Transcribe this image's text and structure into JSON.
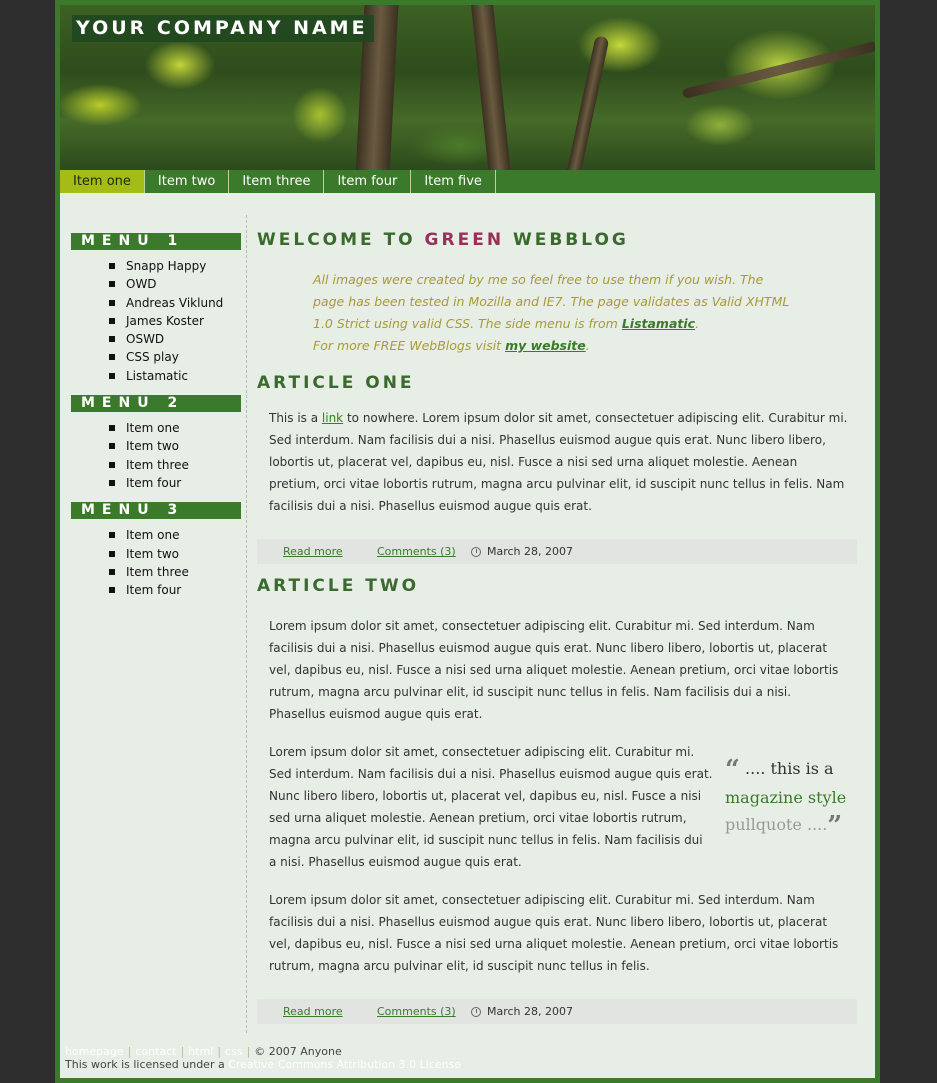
{
  "header": {
    "company": "YOUR COMPANY NAME"
  },
  "nav": {
    "items": [
      "Item one",
      "Item two",
      "Item three",
      "Item four",
      "Item five"
    ]
  },
  "sidebar": {
    "menus": [
      {
        "title": "MENU 1",
        "items": [
          "Snapp Happy",
          "OWD",
          "Andreas Viklund",
          "James Koster",
          "OSWD",
          "CSS play",
          "Listamatic"
        ]
      },
      {
        "title": "MENU 2",
        "items": [
          "Item one",
          "Item two",
          "Item three",
          "Item four"
        ]
      },
      {
        "title": "MENU 3",
        "items": [
          "Item one",
          "Item two",
          "Item three",
          "Item four"
        ]
      }
    ]
  },
  "main": {
    "title_pre": "WELCOME TO ",
    "title_green": "GREEN",
    "title_post": " WEBBLOG",
    "intro": {
      "t1": "All images were created by me so feel free to use them if you wish. The page has been tested in Mozilla and IE7. The page validates as Valid XHTML 1.0 Strict using valid CSS. The side menu is from ",
      "link1": "Listamatic",
      "t2": ".",
      "t3": "For more FREE WebBlogs visit ",
      "link2": "my website",
      "t4": "."
    },
    "article1": {
      "title": "ARTICLE ONE",
      "p_pre": "This is a ",
      "p_link": "link",
      "p_post": " to nowhere. Lorem ipsum dolor sit amet, consectetuer adipiscing elit. Curabitur mi. Sed interdum. Nam facilisis dui a nisi. Phasellus euismod augue quis erat. Nunc libero libero, lobortis ut, placerat vel, dapibus eu, nisl. Fusce a nisi sed urna aliquet molestie. Aenean pretium, orci vitae lobortis rutrum, magna arcu pulvinar elit, id suscipit nunc tellus in felis. Nam facilisis dui a nisi. Phasellus euismod augue quis erat.",
      "read_more": "Read more",
      "comments": "Comments (3)",
      "date": "March 28, 2007"
    },
    "article2": {
      "title": "ARTICLE TWO",
      "p1": "Lorem ipsum dolor sit amet, consectetuer adipiscing elit. Curabitur mi. Sed interdum. Nam facilisis dui a nisi. Phasellus euismod augue quis erat. Nunc libero libero, lobortis ut, placerat vel, dapibus eu, nisl. Fusce a nisi sed urna aliquet molestie. Aenean pretium, orci vitae lobortis rutrum, magna arcu pulvinar elit, id suscipit nunc tellus in felis. Nam facilisis dui a nisi. Phasellus euismod augue quis erat.",
      "p2": "Lorem ipsum dolor sit amet, consectetuer adipiscing elit. Curabitur mi. Sed interdum. Nam facilisis dui a nisi. Phasellus euismod augue quis erat. Nunc libero libero, lobortis ut, placerat vel, dapibus eu, nisl. Fusce a nisi sed urna aliquet molestie. Aenean pretium, orci vitae lobortis rutrum, magna arcu pulvinar elit, id suscipit nunc tellus in felis. Nam facilisis dui a nisi. Phasellus euismod augue quis erat.",
      "p3": "Lorem ipsum dolor sit amet, consectetuer adipiscing elit. Curabitur mi. Sed interdum. Nam facilisis dui a nisi. Phasellus euismod augue quis erat. Nunc libero libero, lobortis ut, placerat vel, dapibus eu, nisl. Fusce a nisi sed urna aliquet molestie. Aenean pretium, orci vitae lobortis rutrum, magna arcu pulvinar elit, id suscipit nunc tellus in felis.",
      "pullquote": {
        "open": "“",
        "a": " .... this is a ",
        "b": "magazine style",
        "c": "pullquote ....",
        "close": "”"
      },
      "read_more": "Read more",
      "comments": "Comments (3)",
      "date": "March 28, 2007"
    }
  },
  "footer": {
    "links": [
      "homepage",
      "contact",
      "html",
      "css"
    ],
    "sep": "|",
    "copyright": "© 2007 Anyone",
    "license_pre": "This work is licensed under a ",
    "license_link": "Creative Commons Attribution 3.0 License"
  },
  "colors": {
    "brand_green": "#3a7a2a",
    "nav_active": "#a6bc16",
    "title_accent": "#9a2f5a",
    "intro_text": "#a89a34"
  }
}
